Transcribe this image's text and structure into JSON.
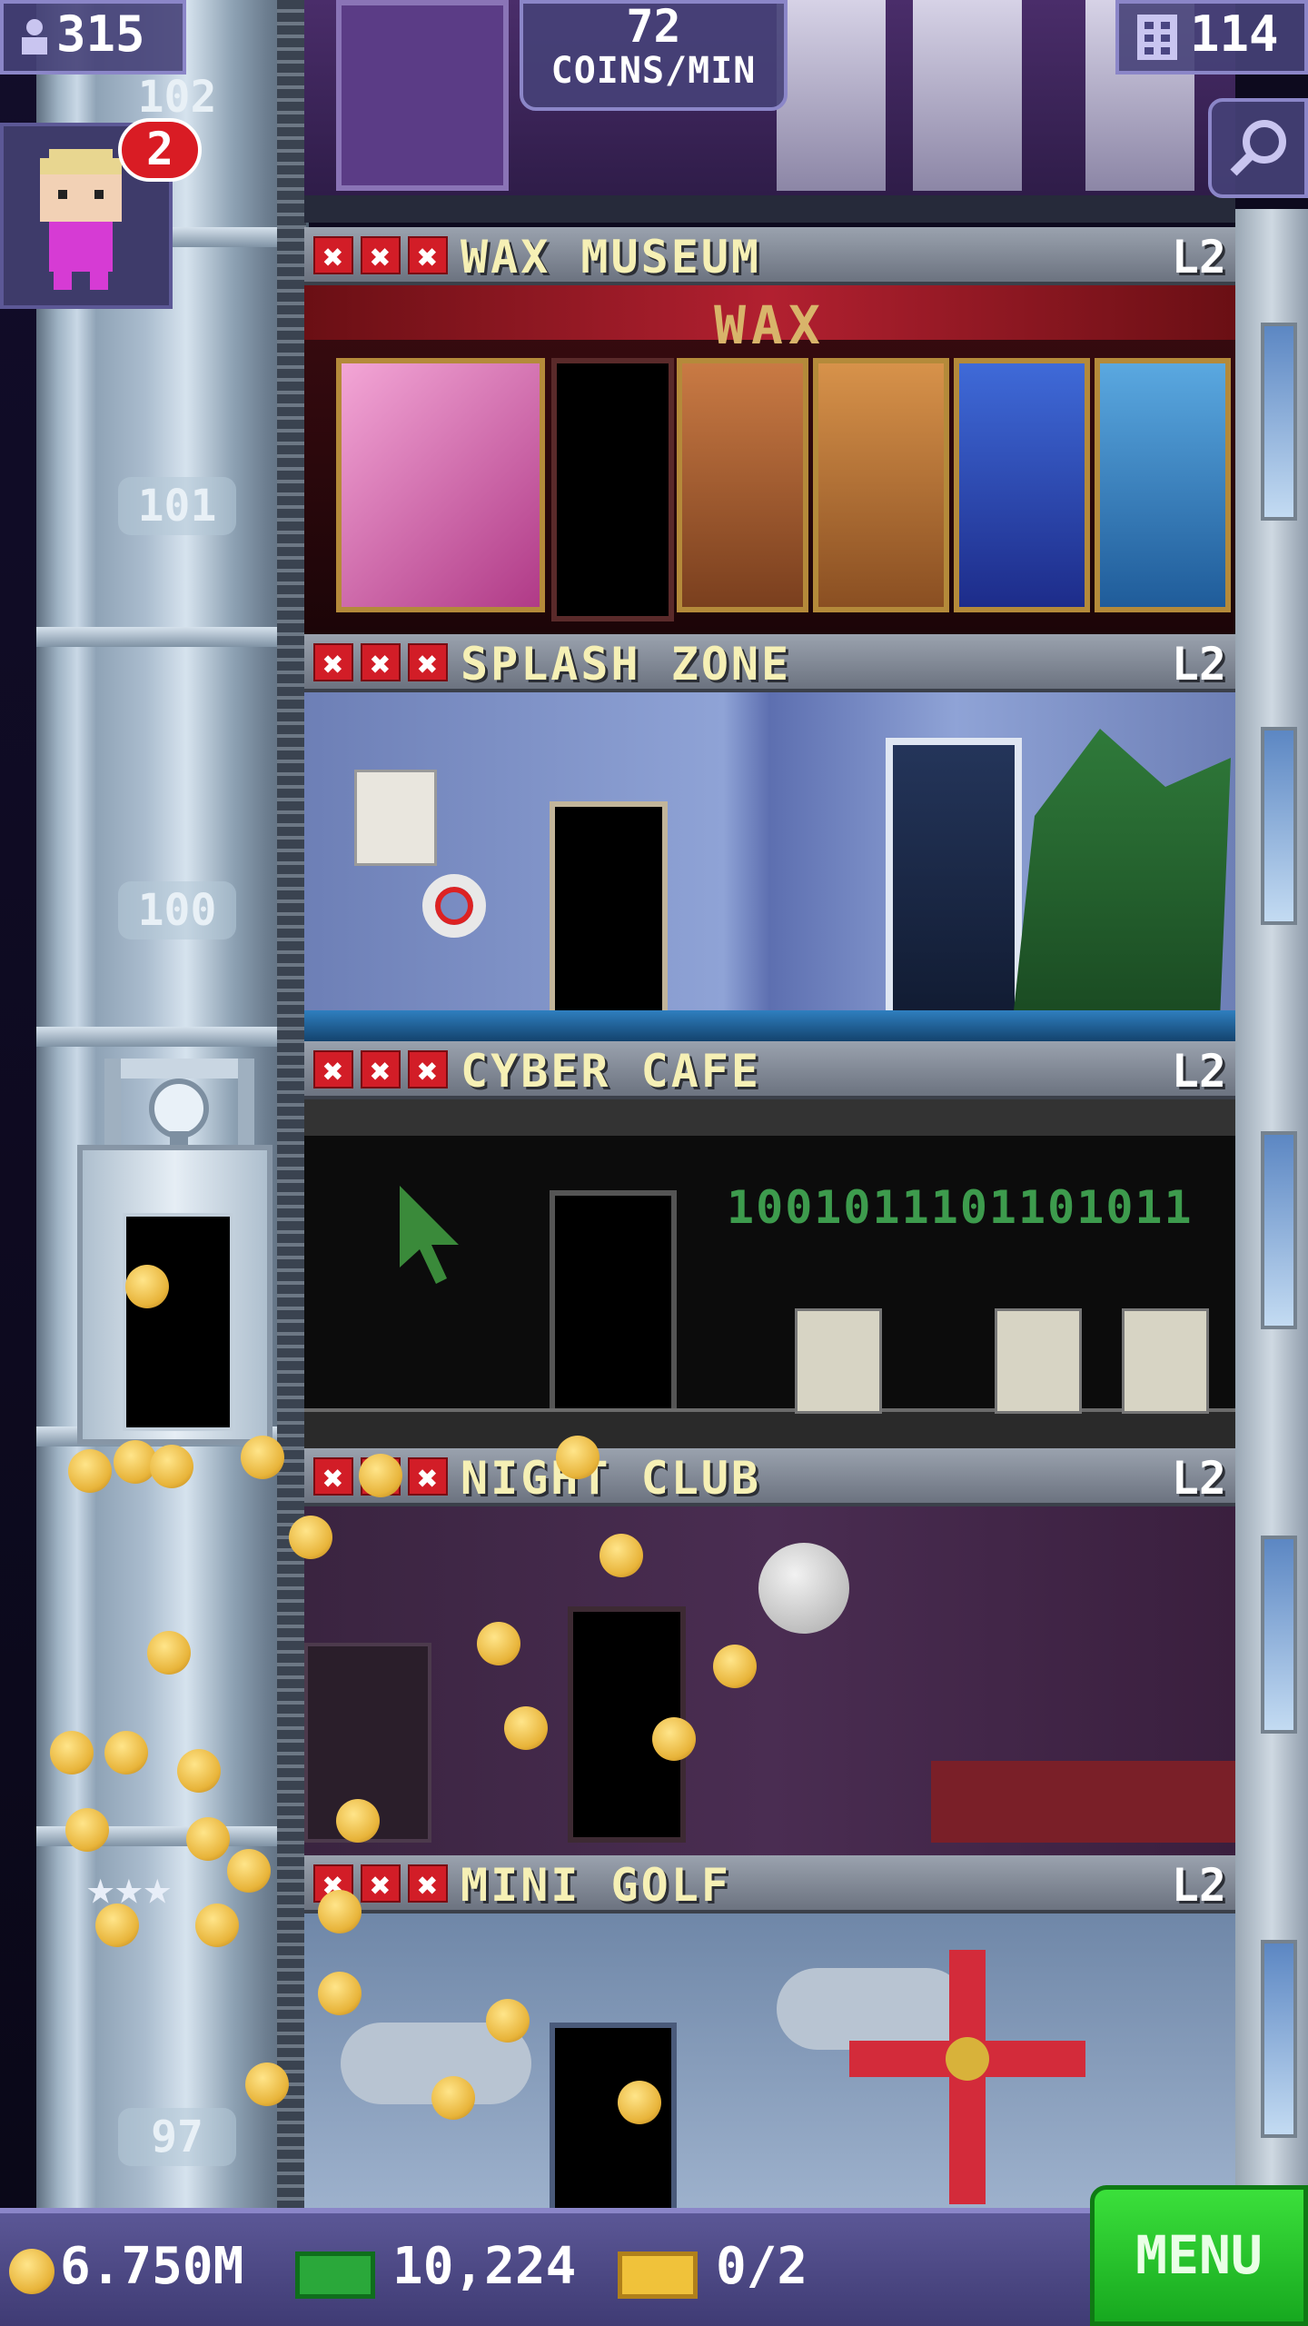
{
  "top_bar": {
    "population": "315",
    "coins_per_min_value": "72",
    "coins_per_min_label": "COINS/MIN",
    "floor_count": "114"
  },
  "visitor_notification_count": "2",
  "elevator": {
    "floor_labels": [
      "102",
      "101",
      "100",
      "97"
    ],
    "stars": "★★★"
  },
  "rooms": [
    {
      "name": "WAX MUSEUM",
      "level": "L2",
      "sign": "WAX"
    },
    {
      "name": "SPLASH ZONE",
      "level": "L2"
    },
    {
      "name": "CYBER CAFE",
      "level": "L2",
      "binary": "1001011101101011"
    },
    {
      "name": "NIGHT CLUB",
      "level": "L2"
    },
    {
      "name": "MINI GOLF",
      "level": "L2"
    }
  ],
  "bottom_bar": {
    "coins": "6.750M",
    "tower_bux": "10,224",
    "tickets": "0/2",
    "menu_label": "MENU"
  },
  "colors": {
    "accent_bar": "#4a4682",
    "menu_green": "#22c12a",
    "room_x_red": "#d21d27",
    "room_name_yellow": "#f6f0b5"
  }
}
